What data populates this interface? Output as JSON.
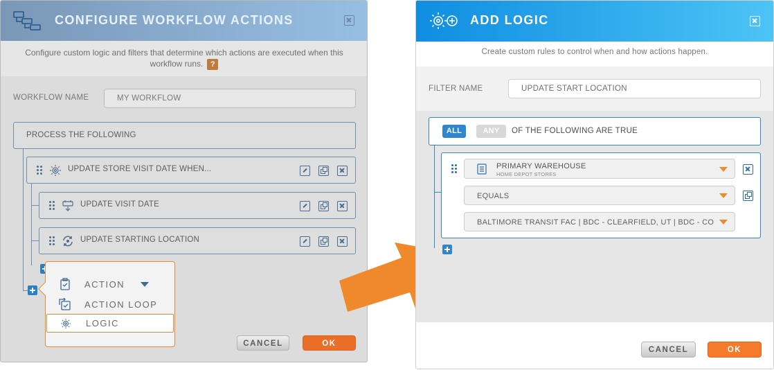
{
  "left_dialog": {
    "title": "CONFIGURE WORKFLOW ACTIONS",
    "description": "Configure custom logic and filters that determine which actions are executed when this workflow runs.",
    "help_label": "?",
    "workflow_name_label": "WORKFLOW NAME",
    "workflow_name_value": "MY WORKFLOW",
    "process_label": "PROCESS THE FOLLOWING",
    "actions": [
      {
        "label": "UPDATE STORE VISIT DATE WHEN...",
        "icon": "logic-bulb-icon"
      },
      {
        "label": "UPDATE VISIT DATE",
        "icon": "calendar-update-icon"
      },
      {
        "label": "UPDATE STARTING LOCATION",
        "icon": "location-refresh-icon"
      }
    ],
    "menu": {
      "items": [
        {
          "label": "ACTION",
          "icon": "clipboard-icon"
        },
        {
          "label": "ACTION LOOP",
          "icon": "loop-icon"
        },
        {
          "label": "LOGIC",
          "icon": "logic-bulb-icon"
        }
      ],
      "selected": "LOGIC"
    },
    "cancel_label": "CANCEL",
    "ok_label": "OK",
    "accent_color": "#e48a36"
  },
  "right_dialog": {
    "title": "ADD LOGIC",
    "description": "Create custom rules to control when and how actions happen.",
    "filter_name_label": "FILTER NAME",
    "filter_name_value": "UPDATE START LOCATION",
    "match_all_label": "ALL",
    "match_any_label": "ANY",
    "condition_text": "OF THE FOLLOWING ARE TRUE",
    "rule": {
      "field_label": "PRIMARY WAREHOUSE",
      "field_source": "HOME DEPOT STORES",
      "operator": "EQUALS",
      "value": "BALTIMORE TRANSIT FAC | BDC - CLEARFIELD, UT | BDC - COLU"
    },
    "cancel_label": "CANCEL",
    "ok_label": "OK",
    "header_color": "#1a9ae6",
    "primary_color": "#2f86cc"
  },
  "arrow_color": "#f0892b"
}
